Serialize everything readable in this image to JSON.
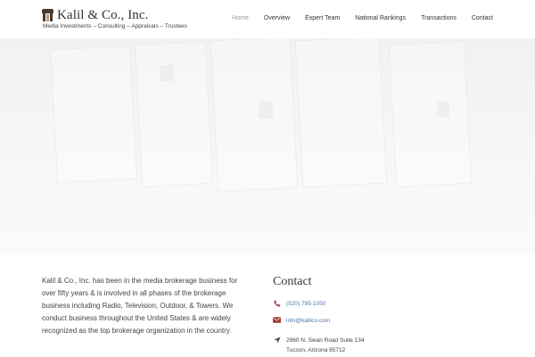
{
  "brand": {
    "name": "Kalil & Co., Inc.",
    "tagline": "Media Investments – Consulting – Appraisals – Trustees"
  },
  "nav": {
    "items": [
      {
        "label": "Home",
        "active": true
      },
      {
        "label": "Overview",
        "active": false
      },
      {
        "label": "Expert Team",
        "active": false
      },
      {
        "label": "National Rankings",
        "active": false
      },
      {
        "label": "Transactions",
        "active": false
      },
      {
        "label": "Contact",
        "active": false
      }
    ]
  },
  "about": {
    "text": "Kalil & Co., Inc. has been in the media brokerage business for over fifty years & is involved in all phases of the brokerage business including Radio, Television, Outdoor, & Towers. We conduct business throughout the United States & are widely recognized as the top brokerage organization in the country."
  },
  "contact": {
    "title": "Contact",
    "phone": "(520) 795-1050",
    "email": "info@kalilco.com",
    "address_line1": "2960 N. Swan Road Suite 134",
    "address_line2": "Tucson, Arizona 85712"
  },
  "icons": {
    "phone": "phone-icon",
    "email": "envelope-icon",
    "address": "location-arrow-icon"
  },
  "colors": {
    "link": "#4a78a8",
    "icon": "#a03a3a",
    "logo": "#4a3a32"
  }
}
